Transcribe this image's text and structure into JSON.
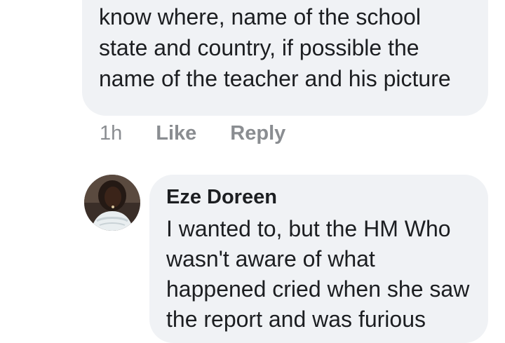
{
  "comment": {
    "text": "know where, name of the school state and country, if possible the name of the teacher and his picture",
    "time": "1h",
    "like_label": "Like",
    "reply_label": "Reply"
  },
  "reply": {
    "author": "Eze Doreen",
    "text": "I wanted to, but the HM Who wasn't aware of what happened cried when she saw the report and was furious"
  },
  "colors": {
    "bubble": "#f0f2f5",
    "text": "#1c1e21",
    "meta": "#8a8d91"
  }
}
